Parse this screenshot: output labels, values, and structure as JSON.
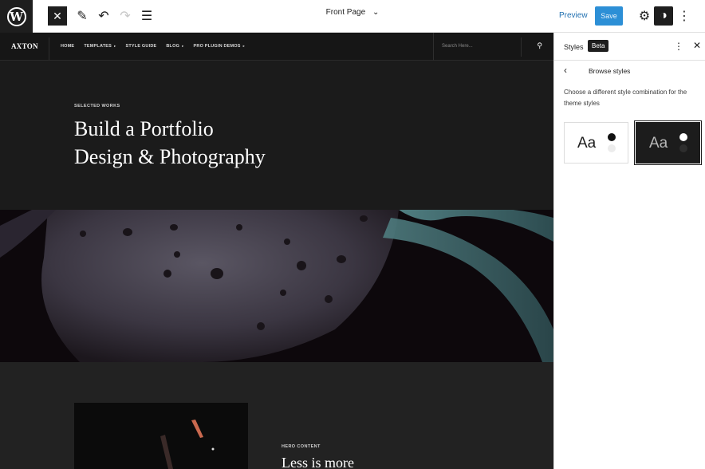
{
  "toolbar": {
    "logo_glyph": "W",
    "close_glyph": "✕",
    "edit_glyph": "✎",
    "undo_glyph": "↶",
    "redo_glyph": "↷",
    "list_glyph": "☰",
    "document_title": "Front Page",
    "document_caret": "⌄",
    "preview_label": "Preview",
    "save_label": "Save",
    "gear_glyph": "⚙",
    "styles_glyph": "◑",
    "more_glyph": "⋮"
  },
  "site": {
    "logo": "AXTON",
    "nav": [
      {
        "label": "HOME",
        "caret": ""
      },
      {
        "label": "TEMPLATES",
        "caret": "▸"
      },
      {
        "label": "STYLE GUIDE",
        "caret": ""
      },
      {
        "label": "BLOG",
        "caret": "▸"
      },
      {
        "label": "PRO PLUGIN DEMOS",
        "caret": "▸"
      }
    ],
    "search_placeholder": "Search Here...",
    "search_glyph": "⚲"
  },
  "hero": {
    "kicker": "SELECTED WORKS",
    "title_line1": "Build a Portfolio",
    "title_line2": "Design & Photography"
  },
  "lower": {
    "kicker": "HERO CONTENT",
    "title": "Less is more"
  },
  "sidebar": {
    "title": "Styles",
    "badge": "Beta",
    "more_glyph": "⋮",
    "close_glyph": "✕",
    "back_glyph": "‹",
    "subtitle": "Browse styles",
    "description": "Choose a different style combination for the theme styles",
    "variations": [
      {
        "label": "Aa",
        "theme": "light",
        "selected": false
      },
      {
        "label": "Aa",
        "theme": "dark",
        "selected": true
      }
    ]
  },
  "colors": {
    "accent": "#2c8fd6",
    "canvas_bg": "#161616",
    "sidebar_bg": "#ffffff"
  }
}
